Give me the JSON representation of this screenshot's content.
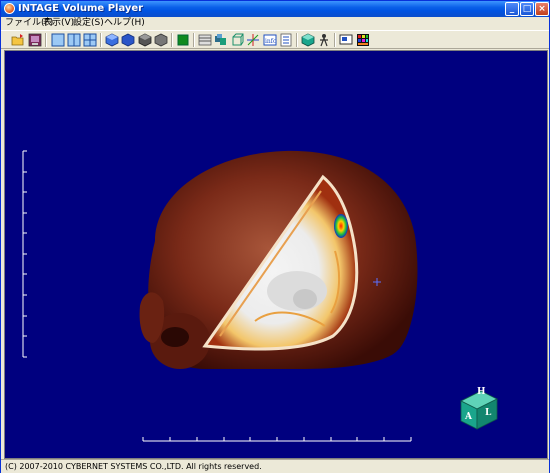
{
  "window": {
    "title": "INTAGE Volume Player",
    "controls": [
      "minimize-icon",
      "maximize-icon",
      "close-icon"
    ]
  },
  "menu": [
    {
      "label": "ファイル(F)"
    },
    {
      "label": "表示(V)"
    },
    {
      "label": "設定(S)"
    },
    {
      "label": "ヘルプ(H)"
    }
  ],
  "toolbar": {
    "icons": [
      "open-folder-icon",
      "save-image-icon",
      "single-view-icon",
      "split-view-icon",
      "quad-view-icon",
      "shaded-cube-icon",
      "blue-cube-icon",
      "gray-cube-icon",
      "dark-cube-icon",
      "green-square-icon",
      "slice-stack-icon",
      "volume-blocks-icon",
      "wireframe-cube-icon",
      "axes-icon",
      "info-icon",
      "document-icon",
      "orientation-cube-icon",
      "person-icon",
      "screen-icon",
      "color-palette-icon"
    ]
  },
  "viewport": {
    "background": "#00007f",
    "orientation_labels": {
      "top": "H",
      "left": "A",
      "right": "L"
    },
    "orientation_color": "#1aa58c"
  },
  "status": {
    "text": "(C) 2007-2010 CYBERNET SYSTEMS CO.,LTD. All rights reserved."
  }
}
